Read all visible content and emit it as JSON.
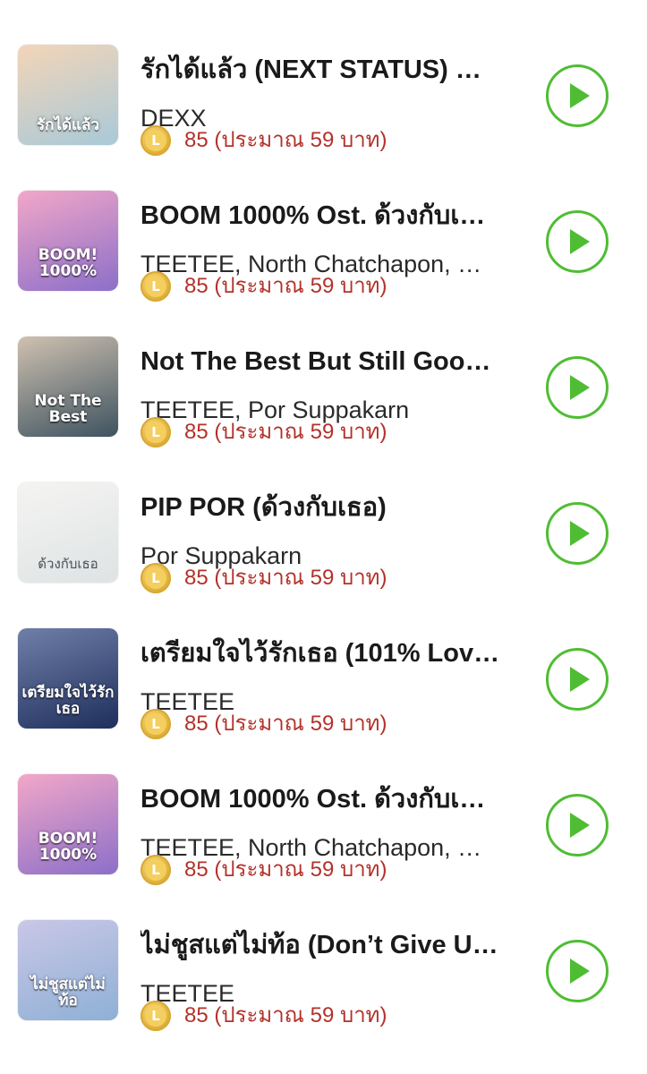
{
  "tracks": [
    {
      "title": "รักได้แล้ว (NEXT STATUS) …",
      "artist": "DEXX",
      "coin_symbol": "L",
      "price": "85 (ประมาณ 59 บาท)",
      "cover_text": "รักได้แล้ว",
      "cover_colors": [
        "#f3d5b8",
        "#a9c9d8"
      ]
    },
    {
      "title": "BOOM 1000% Ost. ด้วงกับเ…",
      "artist": "TEETEE, North Chatchapon, …",
      "coin_symbol": "L",
      "price": "85 (ประมาณ 59 บาท)",
      "cover_text": "BOOM! 1000%",
      "cover_colors": [
        "#f2a7c8",
        "#8c6fc9"
      ]
    },
    {
      "title": "Not The Best But Still Goo…",
      "artist": "TEETEE, Por Suppakarn",
      "coin_symbol": "L",
      "price": "85 (ประมาณ 59 บาท)",
      "cover_text": "Not The Best",
      "cover_colors": [
        "#cfc1b0",
        "#3e5360"
      ]
    },
    {
      "title": "PIP POR (ด้วงกับเธอ)",
      "artist": "Por Suppakarn",
      "coin_symbol": "L",
      "price": "85 (ประมาณ 59 บาท)",
      "cover_text": "ด้วงกับเธอ",
      "cover_colors": [
        "#f4f4f2",
        "#dfe3e4"
      ]
    },
    {
      "title": "เตรียมใจไว้รักเธอ (101% Lov…",
      "artist": "TEETEE",
      "coin_symbol": "L",
      "price": "85 (ประมาณ 59 บาท)",
      "cover_text": "เตรียมใจไว้รักเธอ",
      "cover_colors": [
        "#6f7fa8",
        "#1f2f5c"
      ]
    },
    {
      "title": "BOOM 1000% Ost. ด้วงกับเ…",
      "artist": "TEETEE, North Chatchapon, …",
      "coin_symbol": "L",
      "price": "85 (ประมาณ 59 บาท)",
      "cover_text": "BOOM! 1000%",
      "cover_colors": [
        "#f2a7c8",
        "#8c6fc9"
      ]
    },
    {
      "title": "ไม่ชูสแต่ไม่ท้อ (Don’t Give U…",
      "artist": "TEETEE",
      "coin_symbol": "L",
      "price": "85 (ประมาณ 59 บาท)",
      "cover_text": "ไม่ชูสแต่ไม่ท้อ",
      "cover_colors": [
        "#c9c7e6",
        "#8fb0d6"
      ]
    }
  ],
  "accent_color": "#4fbd33",
  "price_color": "#b3322a",
  "play_icon": "play-icon"
}
